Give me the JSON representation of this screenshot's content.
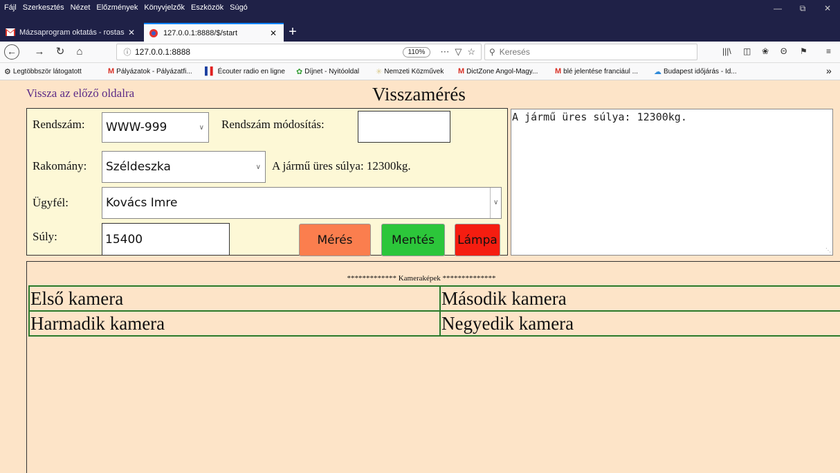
{
  "browser": {
    "menu": [
      "Fájl",
      "Szerkesztés",
      "Nézet",
      "Előzmények",
      "Könyvjelzők",
      "Eszközök",
      "Súgó"
    ],
    "tabs": [
      {
        "title": "Mázsaprogram oktatás - rostas",
        "active": false
      },
      {
        "title": "127.0.0.1:8888/$/start",
        "active": true
      }
    ],
    "url": "127.0.0.1:8888",
    "zoom": "110%",
    "search_placeholder": "Keresés",
    "bookmarks": [
      "Legtöbbször látogatott",
      "Pályázatok - Pályázatfi...",
      "Écouter radio en ligne",
      "Díjnet - Nyitóoldal",
      "Nemzeti Közművek",
      "DictZone Angol-Magy...",
      "blé jelentése franciául ...",
      "Budapest időjárás - Id..."
    ]
  },
  "page": {
    "back_link": "Vissza az előző oldalra",
    "title": "Visszamérés",
    "form": {
      "plate_label": "Rendszám:",
      "plate_value": "WWW-999",
      "plate_edit_label": "Rendszám módosítás:",
      "plate_edit_value": "",
      "cargo_label": "Rakomány:",
      "cargo_value": "Széldeszka",
      "empty_weight_text": "A jármű üres súlya: 12300kg.",
      "client_label": "Ügyfél:",
      "client_value": "Kovács Imre",
      "weight_label": "Súly:",
      "weight_value": "15400",
      "measure_button": "Mérés",
      "save_button": "Mentés",
      "lamp_button": "Lámpa"
    },
    "log_text": "A jármű üres súlya: 12300kg.",
    "cameras": {
      "header": "************* Kameraképek **************",
      "cells": [
        "Első kamera",
        "Második kamera",
        "Harmadik kamera",
        "Negyedik kamera"
      ]
    }
  },
  "colors": {
    "page_bg": "#fde4c8",
    "form_bg": "#fdf8d6",
    "measure_btn": "#fb7e4e",
    "save_btn": "#2cc63a",
    "lamp_btn": "#f51d10",
    "camera_border": "#2a7a2a"
  }
}
